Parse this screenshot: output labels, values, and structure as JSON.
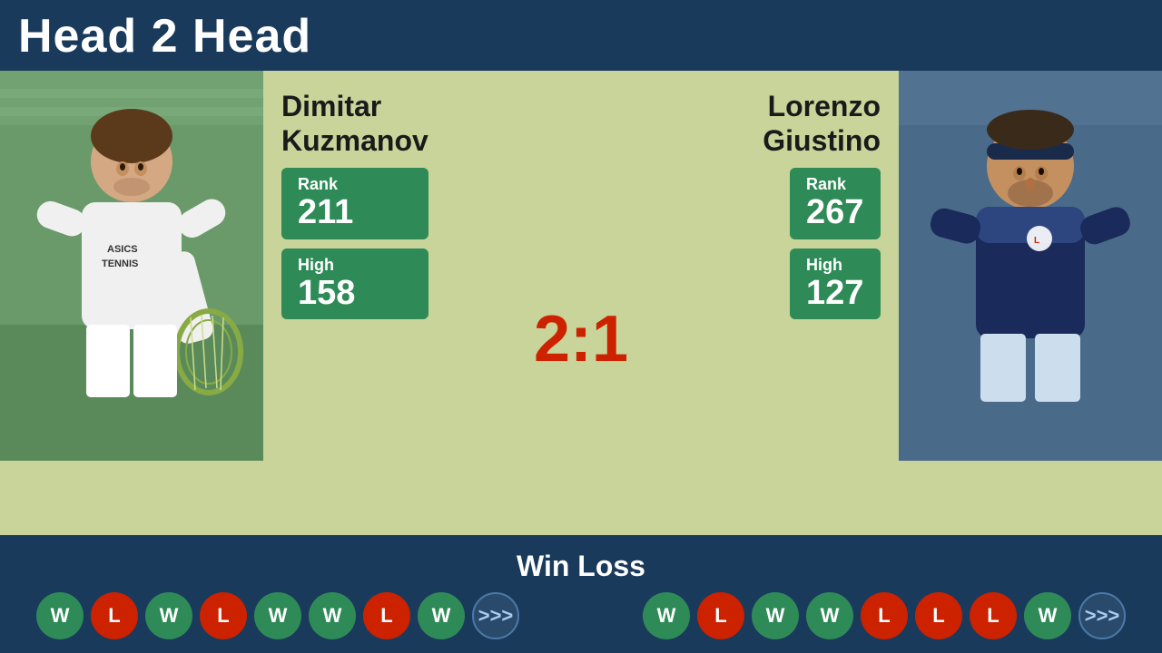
{
  "header": {
    "title": "Head 2 Head"
  },
  "player1": {
    "name_line1": "Dimitar",
    "name_line2": "Kuzmanov",
    "rank_label": "Rank",
    "rank_value": "211",
    "high_label": "High",
    "high_value": "158"
  },
  "player2": {
    "name_line1": "Lorenzo",
    "name_line2": "Giustino",
    "rank_label": "Rank",
    "rank_value": "267",
    "high_label": "High",
    "high_value": "127"
  },
  "score": {
    "value": "2:1"
  },
  "win_loss": {
    "title": "Win Loss",
    "player1_badges": [
      "W",
      "L",
      "W",
      "L",
      "W",
      "W",
      "L",
      "W"
    ],
    "player2_badges": [
      "W",
      "L",
      "W",
      "W",
      "L",
      "L",
      "L",
      "W"
    ],
    "more_label": ">>>"
  }
}
